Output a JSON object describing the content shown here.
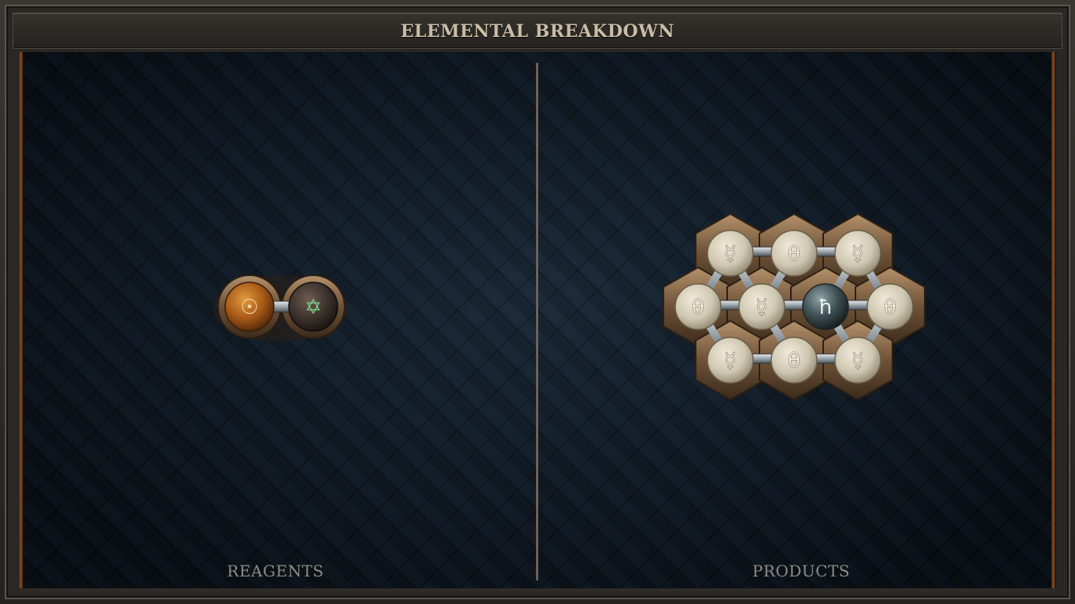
{
  "header": {
    "title": "ELEMENTAL BREAKDOWN"
  },
  "panels": {
    "reagents_label": "REAGENTS",
    "products_label": "PRODUCTS"
  },
  "reagents": {
    "atoms": [
      {
        "element": "sun",
        "symbol": "☉",
        "color": "#b8621d"
      },
      {
        "element": "quintessence",
        "symbol": "✡",
        "color": "#3a2e2a"
      }
    ]
  },
  "products": {
    "atoms": [
      {
        "element": "mercury",
        "symbol": "☿",
        "color": "#d6d0bd"
      },
      {
        "element": "salt",
        "symbol": "θ",
        "color": "#d6d0bd"
      },
      {
        "element": "mercury",
        "symbol": "☿",
        "color": "#d6d0bd"
      },
      {
        "element": "salt",
        "symbol": "θ",
        "color": "#d6d0bd"
      },
      {
        "element": "mercury",
        "symbol": "☿",
        "color": "#d6d0bd"
      },
      {
        "element": "lead",
        "symbol": "ħ",
        "color": "#3b4a4e"
      },
      {
        "element": "salt",
        "symbol": "θ",
        "color": "#d6d0bd"
      },
      {
        "element": "mercury",
        "symbol": "☿",
        "color": "#d6d0bd"
      },
      {
        "element": "salt",
        "symbol": "θ",
        "color": "#d6d0bd"
      },
      {
        "element": "mercury",
        "symbol": "☿",
        "color": "#d6d0bd"
      }
    ]
  }
}
